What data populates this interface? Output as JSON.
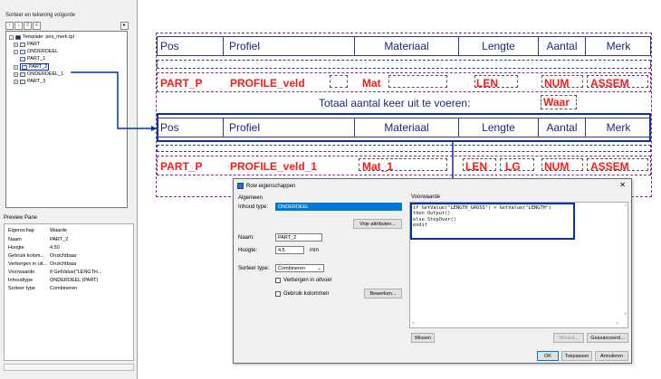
{
  "left_panel": {
    "header": "Sorteer en tekening volgorde",
    "toolbar": [
      "↑",
      "↓",
      "⇧",
      "⇩"
    ],
    "tree": [
      {
        "label": "Template: pos_merk.tpl",
        "expander": "⊟"
      },
      {
        "label": "PART",
        "expander": "⊞"
      },
      {
        "label": "ONDERDEEL",
        "expander": "⊞"
      },
      {
        "label": "PART_1",
        "expander": ""
      },
      {
        "label": "PART_2",
        "expander": "⊞"
      },
      {
        "label": "ONDERDEEL_1",
        "expander": "⊞"
      },
      {
        "label": "PART_3",
        "expander": "⊞"
      }
    ],
    "tree_scroll": "▸"
  },
  "preview": {
    "label": "Preview Pane",
    "rows": [
      {
        "k": "Eigenschap",
        "v": "Waarde"
      },
      {
        "k": "Naam",
        "v": "PART_2"
      },
      {
        "k": "Hoogte",
        "v": "4.50"
      },
      {
        "k": "Gebruik kolom...",
        "v": "Onzichtbaar"
      },
      {
        "k": "Verbergen in uit...",
        "v": "Onzichtbaar"
      },
      {
        "k": "Voorwaarde",
        "v": "if GetValue(\"LENGTH..."
      },
      {
        "k": "Inhoudtype",
        "v": "ONDERDEEL (PART)"
      },
      {
        "k": "Sorteer type",
        "v": "Combineren"
      }
    ]
  },
  "template": {
    "header1": [
      "Pos",
      "Profiel",
      "Materiaal",
      "Lengte",
      "Aantal",
      "Merk"
    ],
    "row1": [
      "PART_P",
      "PROFILE_veld",
      "Mat",
      "LEN",
      "NUM",
      "ASSEM"
    ],
    "total_text": "Totaal aantal keer uit te voeren:",
    "waar": "Waar",
    "header2": [
      "Pos",
      "Profiel",
      "Materiaal",
      "Lengte",
      "Aantal",
      "Merk"
    ],
    "row2": [
      "PART_P",
      "PROFILE_veld_1",
      "Mat_1",
      "LEN",
      "LG",
      "NUM",
      "ASSEM"
    ]
  },
  "dialog": {
    "title": "Row eigenschappen",
    "close": "✕",
    "group_algemeen": "Algemeen",
    "inhoud_type_label": "Inhoud type:",
    "inhoud_type_value": "ONDERDEEL",
    "vrije_attributen": "Vrije attributen...",
    "naam_label": "Naam:",
    "naam_value": "PART_2",
    "hoogte_label": "Hoogte:",
    "hoogte_value": "4.5",
    "hoogte_unit": "mm",
    "sorteer_label": "Sorteer type:",
    "sorteer_value": "Combineren",
    "verbergen_label": "Verbergen in uitvoer",
    "gebruik_label": "Gebruik kolommen",
    "bewerken": "Bewerken...",
    "voorwaarde_label": "Voorwaarde",
    "code": "if GetValue(\"LENGTH_GROSS\") > GetValue(\"LENGTH\")\nthen Output()\nelse StepOver()\nendif",
    "wissen": "Wissen",
    "wizard": "Wizard...",
    "geavanceerd": "Geavanceerd...",
    "ok": "OK",
    "toepassen": "Toepassen",
    "annuleren": "Annuleren"
  },
  "colors": {
    "highlight": "#0030c0",
    "header_text": "#1a2a7a",
    "field_red": "#ff1a1a",
    "selection": "#0078d7"
  }
}
